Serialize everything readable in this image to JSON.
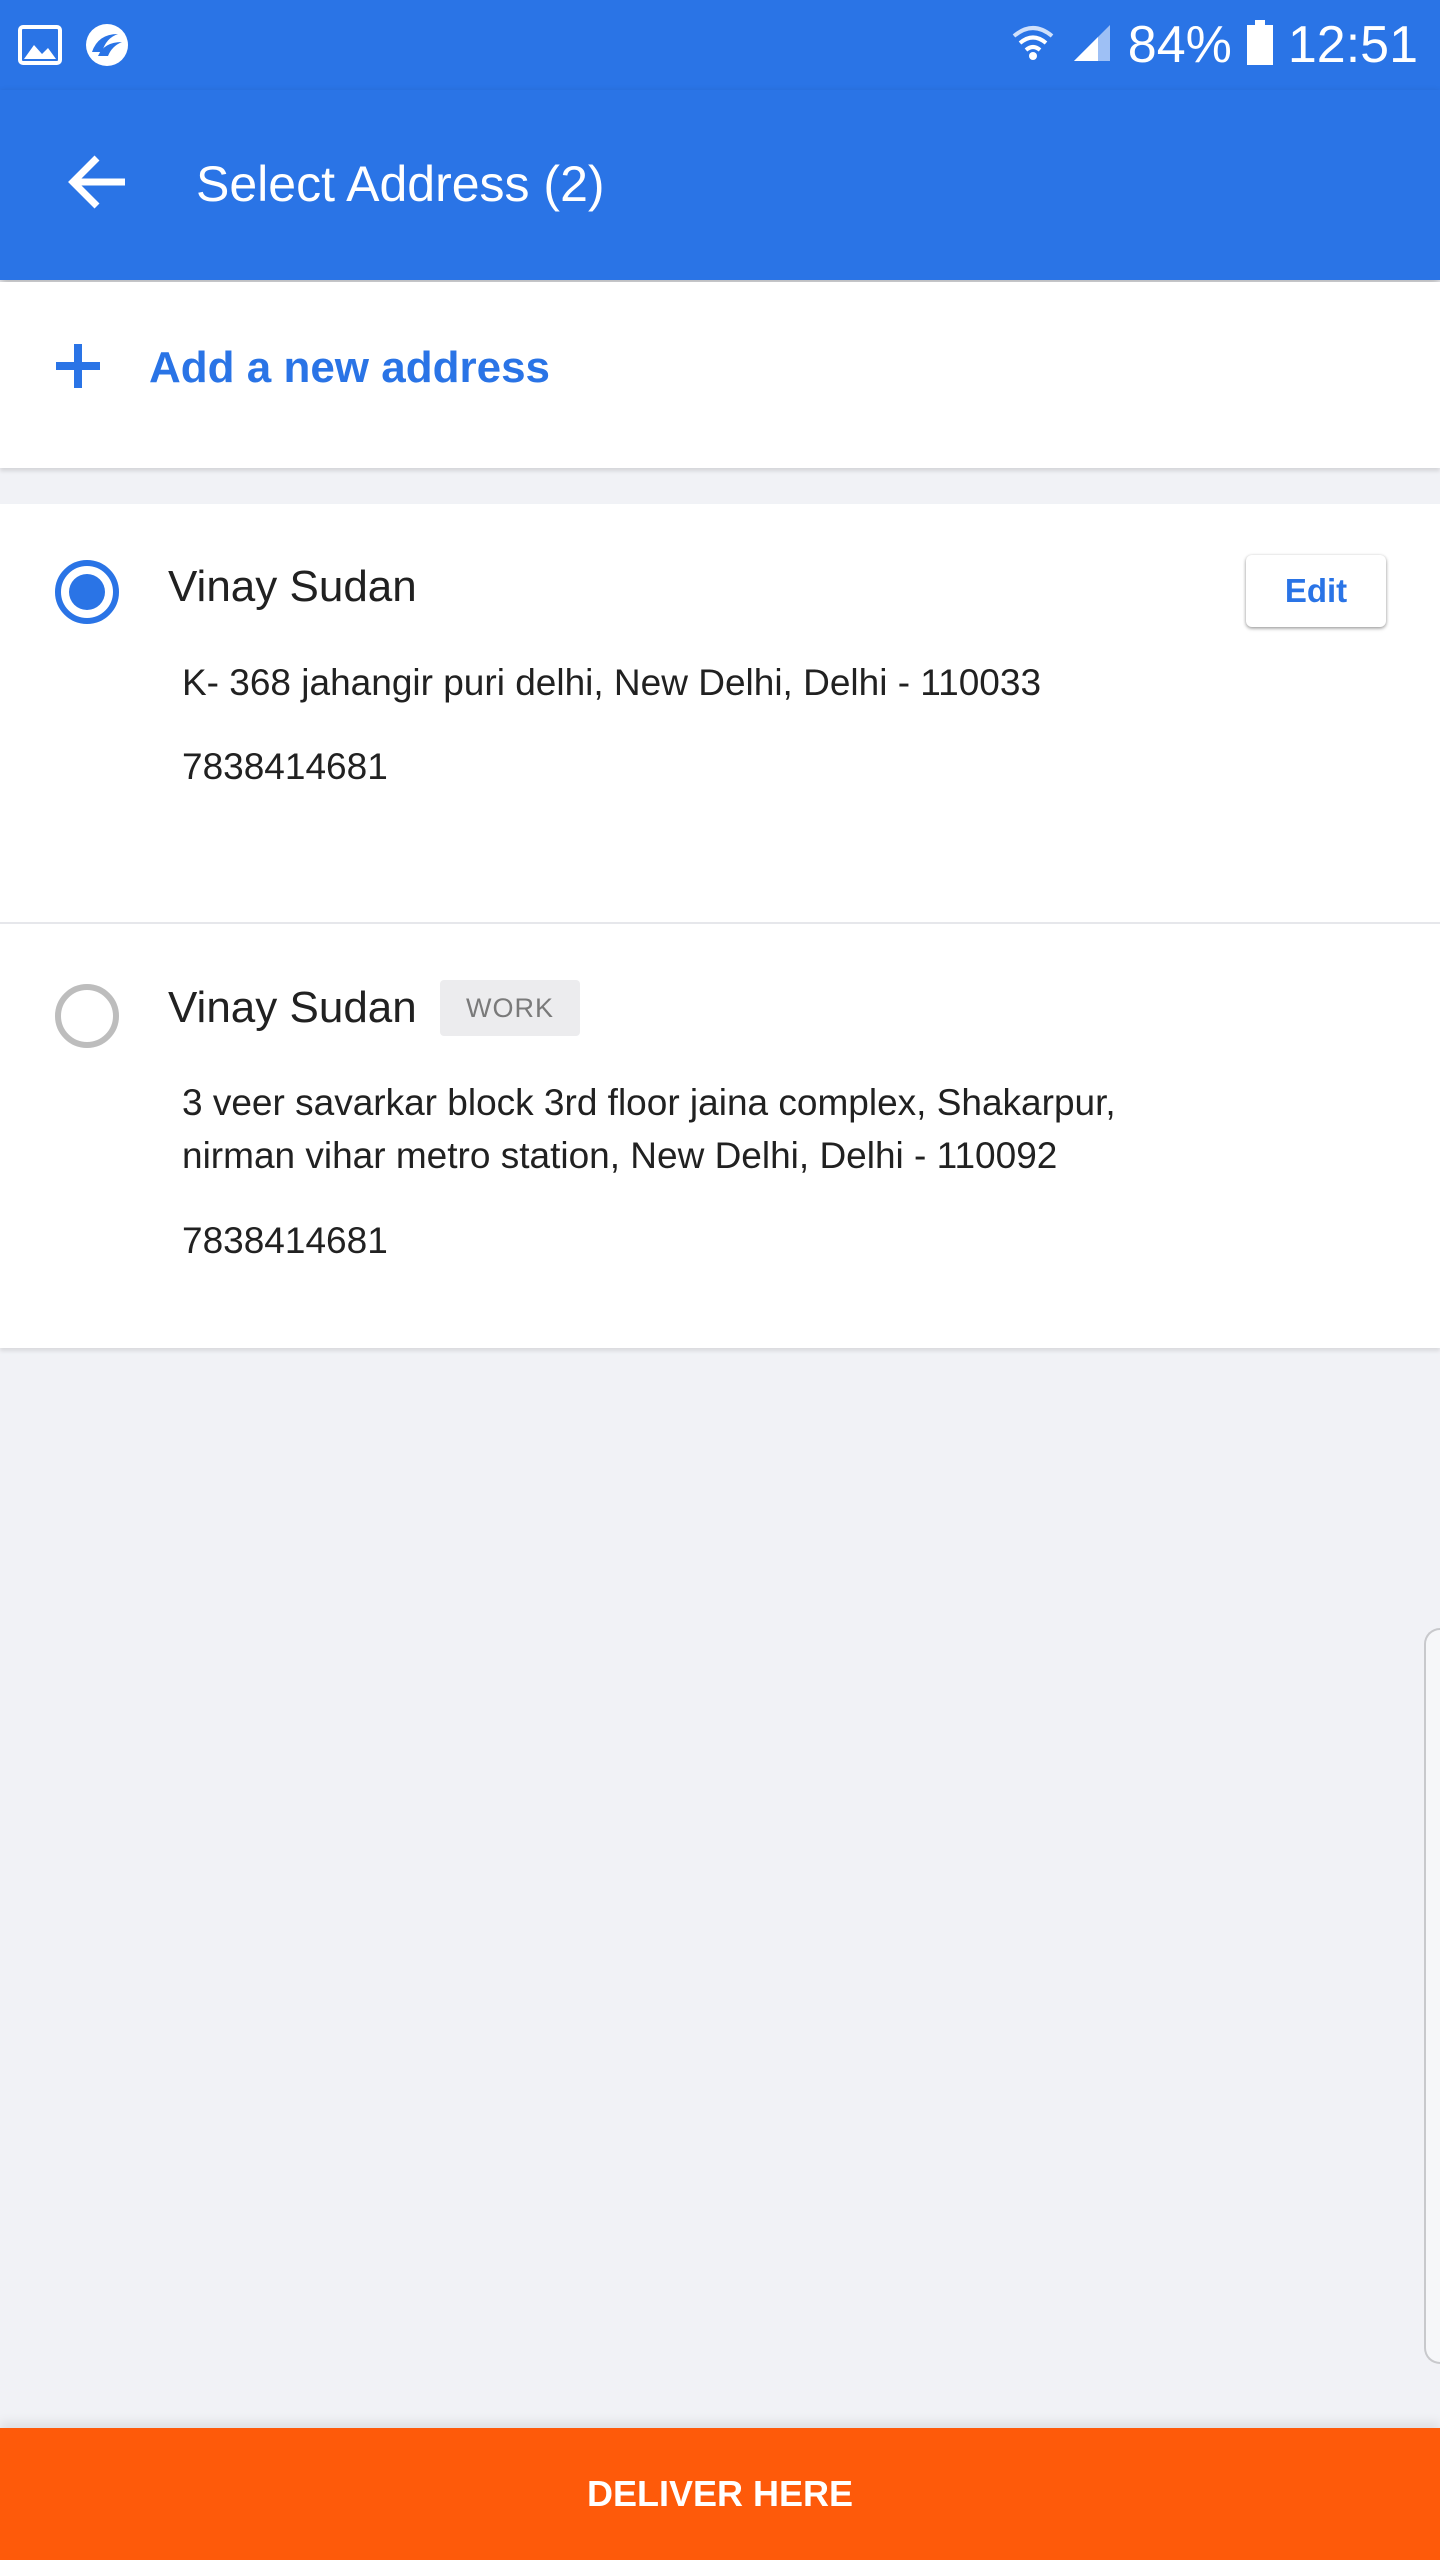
{
  "status_bar": {
    "left_icons": [
      "gallery-icon",
      "browser-icon"
    ],
    "right_icons": [
      "wifi-icon",
      "signal-icon",
      "battery-icon"
    ],
    "battery": "84%",
    "time": "12:51"
  },
  "app_bar": {
    "back_icon": "arrow-left-icon",
    "title": "Select Address (2)"
  },
  "add_address": {
    "icon": "plus-icon",
    "label": "Add a new address"
  },
  "addresses": [
    {
      "name": "Vinay Sudan",
      "selected": true,
      "tag": "",
      "address": "K- 368 jahangir puri delhi, New Delhi, Delhi - 110033",
      "phone": "7838414681",
      "edit_label": "Edit"
    },
    {
      "name": "Vinay Sudan",
      "selected": false,
      "tag": "WORK",
      "address_line1": "3 veer savarkar block 3rd floor jaina complex, Shakarpur,",
      "address_line2": "nirman vihar metro station, New Delhi, Delhi - 110092",
      "phone": "7838414681"
    }
  ],
  "cta": {
    "label": "DELIVER HERE"
  },
  "colors": {
    "primary": "#2a74e6",
    "cta": "#fe5a0a",
    "background": "#f1f2f6"
  }
}
